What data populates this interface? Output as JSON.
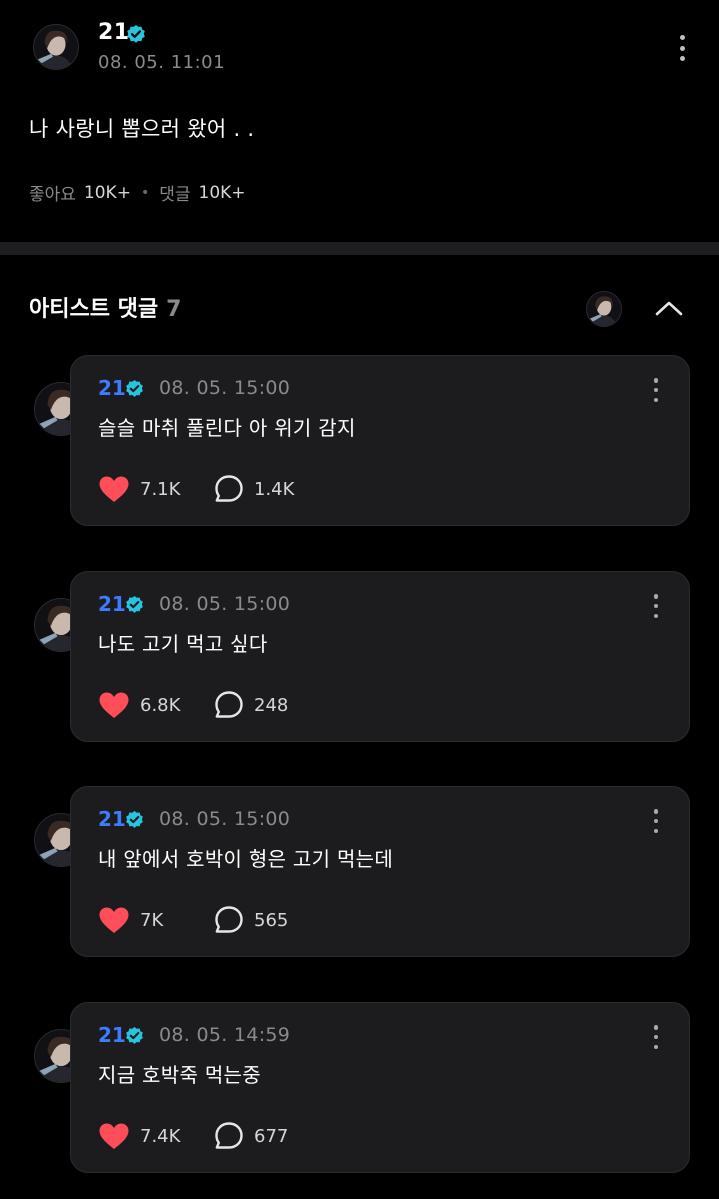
{
  "post": {
    "author": "21",
    "time": "08. 05. 11:01",
    "body": "나 사랑니 뽑으러 왔어 . .",
    "likes_label": "좋아요",
    "likes_count": "10K+",
    "comments_label": "댓글",
    "comments_count": "10K+"
  },
  "section": {
    "title": "아티스트 댓글",
    "count": "7"
  },
  "comments": [
    {
      "author": "21",
      "time": "08. 05. 15:00",
      "text": "슬슬 마취 풀린다 아 위기 감지",
      "likes": "7.1K",
      "replies": "1.4K"
    },
    {
      "author": "21",
      "time": "08. 05. 15:00",
      "text": "나도 고기 먹고 싶다",
      "likes": "6.8K",
      "replies": "248"
    },
    {
      "author": "21",
      "time": "08. 05. 15:00",
      "text": "내 앞에서 호박이 형은 고기 먹는데",
      "likes": "7K",
      "replies": "565"
    },
    {
      "author": "21",
      "time": "08. 05. 14:59",
      "text": "지금 호박죽 먹는중",
      "likes": "7.4K",
      "replies": "677"
    }
  ],
  "icons": {
    "verified": "verified-badge-icon",
    "more": "more-vertical-icon",
    "collapse": "chevron-up-icon",
    "like": "heart-icon",
    "reply": "speech-bubble-icon"
  },
  "colors": {
    "background": "#000000",
    "card": "#1c1c1e",
    "author_blue": "#3d7cff",
    "verified": "#27c4e0",
    "heart": "#ff4d5a",
    "muted": "#8a8a8e"
  }
}
